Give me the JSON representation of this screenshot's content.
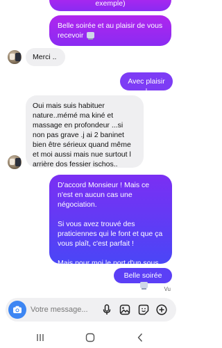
{
  "messages": [
    {
      "id": 0,
      "side": "out",
      "lines": [
        "exemple)"
      ]
    },
    {
      "id": 1,
      "side": "out",
      "text": "Belle soirée et au plaisir de vous recevoir",
      "emoji": "face-emoji"
    },
    {
      "id": 2,
      "side": "in",
      "text": "Merci .."
    },
    {
      "id": 3,
      "side": "out",
      "text": "Avec plaisir !"
    },
    {
      "id": 4,
      "side": "in",
      "text": "Oui mais suis habituer nature..mémé ma kiné et massage en profondeur ...si non pas grave .j ai 2 baninet bien être sérieux quand même et moi aussi mais nue surtout l arrière dos fessier ischos.."
    },
    {
      "id": 5,
      "side": "out",
      "paragraphs": [
        "D'accord Monsieur ! Mais ce n'est en aucun cas une négociation.",
        "Si vous avez trouvé des praticiennes qui le font et que ça vous plaît, c'est parfait !",
        "Mais pour moi le port d'un sous vêtement est obligatoire"
      ]
    },
    {
      "id": 6,
      "side": "out",
      "text": "Belle soirée",
      "emoji": "face-emoji"
    }
  ],
  "seen_label": "Vu",
  "composer": {
    "placeholder": "Votre message...",
    "icons": [
      "camera-icon",
      "microphone-icon",
      "gallery-icon",
      "sticker-icon",
      "plus-icon"
    ],
    "camera_color": "#3d86f3"
  },
  "navbar": {
    "icons": [
      "recent-apps-icon",
      "home-icon",
      "back-icon"
    ]
  },
  "colors": {
    "outgoing_gradient_top": "#b026ee",
    "outgoing_gradient_bottom": "#4a46f6",
    "incoming_bubble": "#efeff1"
  }
}
